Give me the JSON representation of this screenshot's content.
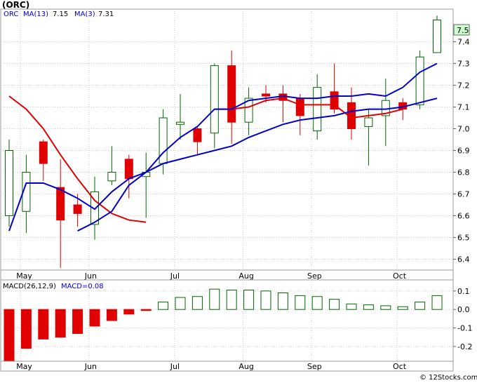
{
  "chart_data": {
    "type": "candlestick",
    "title": "(ORC)",
    "legend": {
      "ticker": "ORC",
      "ma13_label": "MA(13)",
      "ma13_value": "7.15",
      "ma3_label": "MA(3)",
      "ma3_value": "7.31",
      "colors": {
        "ma13": "#0000cc",
        "ma3": "#e00000",
        "up": "#006600",
        "down": "#e00000"
      }
    },
    "last_price_label": "7.5",
    "watermark": "© 12Stocks.com",
    "x_labels": [
      {
        "label": "May",
        "bar": 1
      },
      {
        "label": "Jun",
        "bar": 5
      },
      {
        "label": "Jul",
        "bar": 10
      },
      {
        "label": "Aug",
        "bar": 14
      },
      {
        "label": "Sep",
        "bar": 18
      },
      {
        "label": "Oct",
        "bar": 23
      }
    ],
    "price_panel": {
      "ylim": [
        6.35,
        7.55
      ],
      "yticks": [
        "6.4",
        "6.5",
        "6.6",
        "6.7",
        "6.8",
        "6.9",
        "7.0",
        "7.1",
        "7.2",
        "7.3",
        "7.4"
      ],
      "candles": [
        {
          "open": 6.6,
          "high": 6.95,
          "low": 6.55,
          "close": 6.9
        },
        {
          "open": 6.62,
          "high": 6.88,
          "low": 6.52,
          "close": 6.8
        },
        {
          "open": 6.94,
          "high": 6.95,
          "low": 6.76,
          "close": 6.84
        },
        {
          "open": 6.73,
          "high": 6.86,
          "low": 6.36,
          "close": 6.58
        },
        {
          "open": 6.65,
          "high": 6.7,
          "low": 6.55,
          "close": 6.61
        },
        {
          "open": 6.56,
          "high": 6.78,
          "low": 6.49,
          "close": 6.71
        },
        {
          "open": 6.76,
          "high": 6.92,
          "low": 6.74,
          "close": 6.8
        },
        {
          "open": 6.86,
          "high": 6.88,
          "low": 6.68,
          "close": 6.77
        },
        {
          "open": 6.78,
          "high": 6.89,
          "low": 6.59,
          "close": 6.8
        },
        {
          "open": 6.84,
          "high": 7.09,
          "low": 6.79,
          "close": 7.05
        },
        {
          "open": 7.02,
          "high": 7.16,
          "low": 6.95,
          "close": 7.03
        },
        {
          "open": 7.0,
          "high": 7.01,
          "low": 6.88,
          "close": 6.94
        },
        {
          "open": 6.98,
          "high": 7.3,
          "low": 6.91,
          "close": 7.29
        },
        {
          "open": 7.29,
          "high": 7.36,
          "low": 6.93,
          "close": 7.03
        },
        {
          "open": 7.03,
          "high": 7.19,
          "low": 6.97,
          "close": 7.14
        },
        {
          "open": 7.16,
          "high": 7.2,
          "low": 7.12,
          "close": 7.15
        },
        {
          "open": 7.16,
          "high": 7.2,
          "low": 7.03,
          "close": 7.13
        },
        {
          "open": 7.14,
          "high": 7.16,
          "low": 6.97,
          "close": 7.06
        },
        {
          "open": 6.99,
          "high": 7.25,
          "low": 6.95,
          "close": 7.19
        },
        {
          "open": 7.17,
          "high": 7.3,
          "low": 7.07,
          "close": 7.09
        },
        {
          "open": 7.12,
          "high": 7.19,
          "low": 6.95,
          "close": 7.0
        },
        {
          "open": 7.01,
          "high": 7.09,
          "low": 6.83,
          "close": 7.05
        },
        {
          "open": 7.06,
          "high": 7.23,
          "low": 6.92,
          "close": 7.13
        },
        {
          "open": 7.12,
          "high": 7.14,
          "low": 7.04,
          "close": 7.09
        },
        {
          "open": 7.11,
          "high": 7.36,
          "low": 7.09,
          "close": 7.33
        },
        {
          "open": 7.35,
          "high": 7.52,
          "low": 7.35,
          "close": 7.5
        }
      ],
      "ma3": [
        7.15,
        7.09,
        7.0,
        6.88,
        6.77,
        6.67,
        6.61,
        6.58,
        6.57
      ],
      "ma3_start_bar": 0,
      "ma3_tail": [
        7.09,
        7.09,
        7.1,
        7.13,
        7.14,
        7.11,
        7.11,
        7.11,
        7.05,
        7.06,
        7.07,
        7.09
      ],
      "ma3_tail_start_bar": 12,
      "ma13": [
        6.53,
        6.75,
        6.75,
        6.72,
        6.68,
        6.63,
        6.71,
        6.77,
        6.8,
        6.89,
        6.96,
        7.01,
        7.09,
        7.09,
        7.13,
        7.14,
        7.15,
        7.14,
        7.14,
        7.15,
        7.15,
        7.16,
        7.15,
        7.19,
        7.26,
        7.3
      ],
      "ma13_slow": [
        6.53,
        6.57,
        6.62,
        6.74,
        6.8,
        6.84,
        6.86,
        6.88,
        6.9,
        6.92,
        6.96,
        6.99,
        7.02,
        7.04,
        7.05,
        7.06,
        7.08,
        7.09,
        7.09,
        7.1,
        7.12,
        7.14
      ]
    },
    "macd_panel": {
      "label": "MACD(26,12,9)",
      "value_label": "MACD=0.08",
      "ylim": [
        -0.28,
        0.16
      ],
      "yticks": [
        "0.1",
        "0.0",
        "-0.1",
        "-0.2"
      ],
      "values": [
        -0.28,
        -0.21,
        -0.16,
        -0.15,
        -0.13,
        -0.09,
        -0.06,
        -0.025,
        -0.005,
        0.04,
        0.065,
        0.07,
        0.11,
        0.105,
        0.105,
        0.1,
        0.09,
        0.075,
        0.07,
        0.055,
        0.03,
        0.025,
        0.02,
        0.015,
        0.04,
        0.075
      ]
    }
  }
}
